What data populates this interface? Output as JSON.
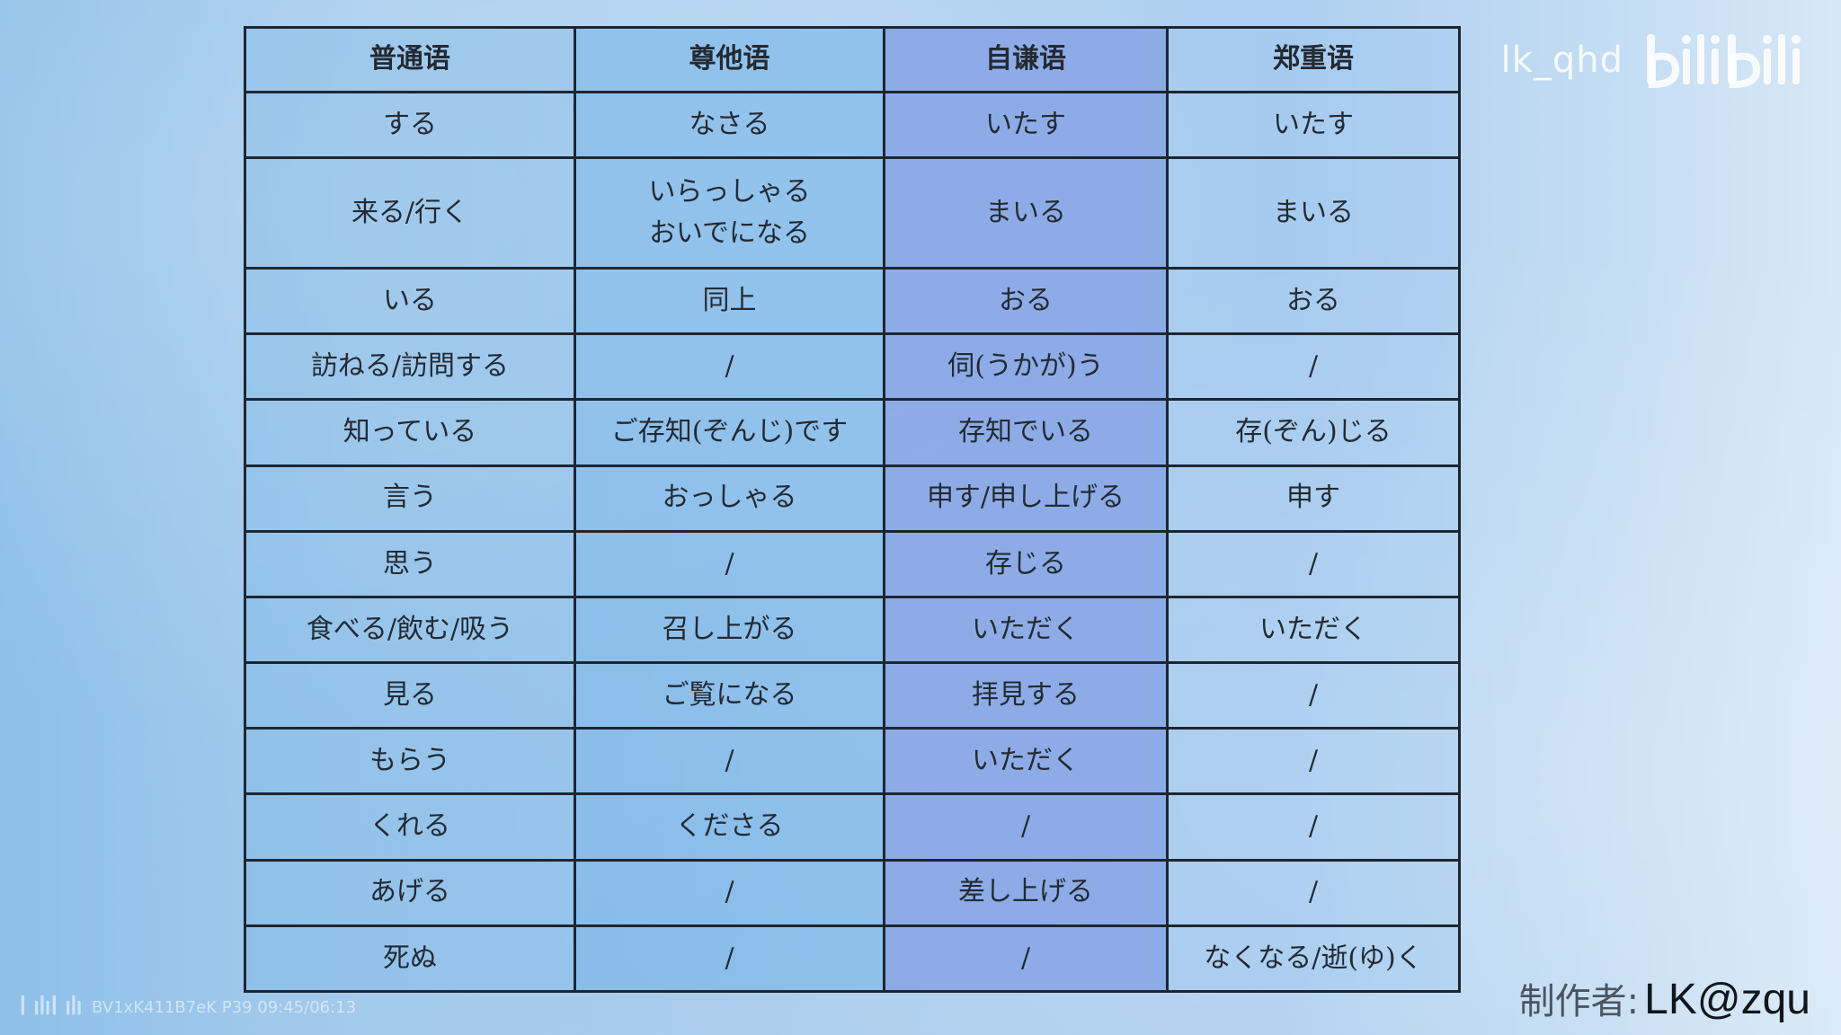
{
  "table": {
    "headers": [
      "普通语",
      "尊他语",
      "自谦语",
      "郑重语"
    ],
    "rows": [
      [
        "する",
        "なさる",
        "いたす",
        "いたす"
      ],
      [
        "来る/行く",
        "いらっしゃる\nおいでになる",
        "まいる",
        "まいる"
      ],
      [
        "いる",
        "同上",
        "おる",
        "おる"
      ],
      [
        "訪ねる/訪問する",
        "/",
        "伺(うかが)う",
        "/"
      ],
      [
        "知っている",
        "ご存知(ぞんじ)です",
        "存知でいる",
        "存(ぞん)じる"
      ],
      [
        "言う",
        "おっしゃる",
        "申す/申し上げる",
        "申す"
      ],
      [
        "思う",
        "/",
        "存じる",
        "/"
      ],
      [
        "食べる/飲む/吸う",
        "召し上がる",
        "いただく",
        "いただく"
      ],
      [
        "見る",
        "ご覧になる",
        "拝見する",
        "/"
      ],
      [
        "もらう",
        "/",
        "いただく",
        "/"
      ],
      [
        "くれる",
        "くださる",
        "/",
        "/"
      ],
      [
        "あげる",
        "/",
        "差し上げる",
        "/"
      ],
      [
        "死ぬ",
        "/",
        "/",
        "なくなる/逝(ゆ)く"
      ]
    ]
  },
  "watermark": {
    "username": "lk_qhd",
    "logo_icon": "bilibili-logo-icon",
    "bottom_text": "BV1xK411B7eK P39 09:45/06:13"
  },
  "author": {
    "label": "制作者:",
    "name": "LK@zqu"
  },
  "colors": {
    "border": "#1e2630",
    "self_humble_column": "#8fa8e8",
    "background": "#b4d4f0"
  }
}
